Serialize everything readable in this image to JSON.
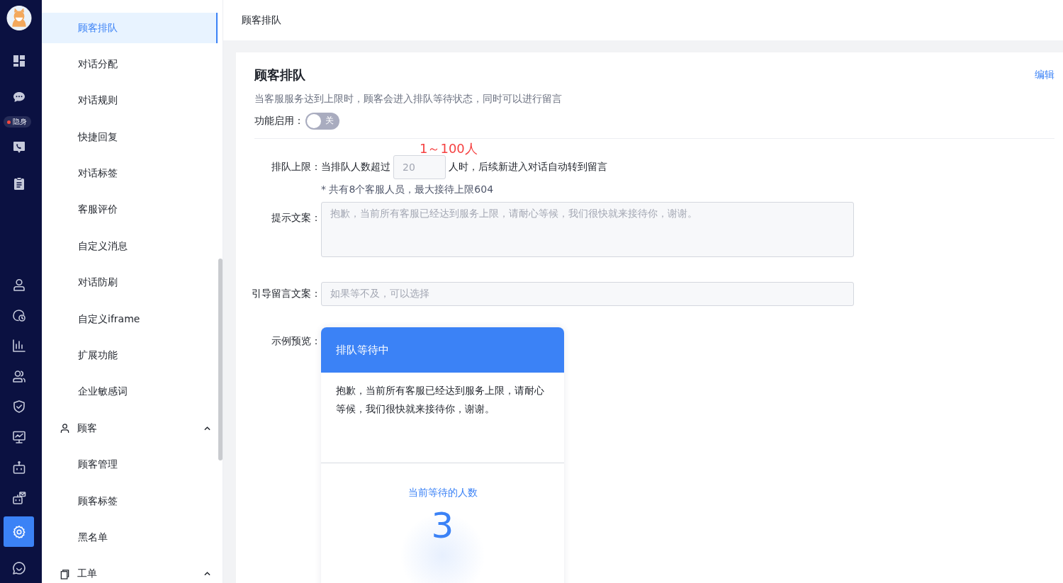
{
  "rail": {
    "items": [
      {
        "selected": false
      },
      {
        "selected": false
      },
      {
        "selected": false
      },
      {
        "selected": false
      },
      {
        "selected": false
      },
      {
        "selected": false
      },
      {
        "selected": false
      },
      {
        "selected": false
      },
      {
        "selected": false
      },
      {
        "selected": false
      },
      {
        "selected": false
      },
      {
        "selected": false
      },
      {
        "selected": true
      },
      {
        "selected": false
      }
    ],
    "status_badge": {
      "label": "隐身"
    }
  },
  "sidebar": {
    "items": [
      {
        "kind": "item",
        "label": "顾客排队",
        "selected": true
      },
      {
        "kind": "item",
        "label": "对话分配",
        "selected": false
      },
      {
        "kind": "item",
        "label": "对话规则",
        "selected": false
      },
      {
        "kind": "item",
        "label": "快捷回复",
        "selected": false
      },
      {
        "kind": "item",
        "label": "对话标签",
        "selected": false
      },
      {
        "kind": "item",
        "label": "客服评价",
        "selected": false
      },
      {
        "kind": "item",
        "label": "自定义消息",
        "selected": false
      },
      {
        "kind": "item",
        "label": "对话防刷",
        "selected": false
      },
      {
        "kind": "item",
        "label": "自定义iframe",
        "selected": false
      },
      {
        "kind": "item",
        "label": "扩展功能",
        "selected": false
      },
      {
        "kind": "item",
        "label": "企业敏感词",
        "selected": false
      },
      {
        "kind": "group",
        "label": "顾客",
        "expanded": true
      },
      {
        "kind": "item",
        "label": "顾客管理",
        "selected": false
      },
      {
        "kind": "item",
        "label": "顾客标签",
        "selected": false
      },
      {
        "kind": "item",
        "label": "黑名单",
        "selected": false
      },
      {
        "kind": "group",
        "label": "工单",
        "expanded": true
      }
    ]
  },
  "header": {
    "title": "顾客排队"
  },
  "card": {
    "title": "顾客排队",
    "edit_link": "编辑",
    "description": "当客服服务达到上限时，顾客会进入排队等待状态，同时可以进行留言",
    "toggle": {
      "label": "功能启用：",
      "on": false,
      "text": "关"
    },
    "limit": {
      "label": "排队上限：",
      "prefix": "当排队人数超过",
      "value": "20",
      "disabled": true,
      "suffix": "人时，后续新进入对话自动转到留言",
      "hint": "1～100人",
      "note": "* 共有8个客服人员，最大接待上限604"
    },
    "prompt": {
      "label": "提示文案：",
      "value": "抱歉，当前所有客服已经达到服务上限，请耐心等候，我们很快就来接待你，谢谢。",
      "disabled": true
    },
    "guide": {
      "label": "引导留言文案：",
      "value": "如果等不及，可以选择",
      "disabled": true
    },
    "preview": {
      "label": "示例预览：",
      "header": "排队等待中",
      "message": "抱歉，当前所有客服已经达到服务上限，请耐心等候，我们很快就来接待你，谢谢。",
      "count_label": "当前等待的人数",
      "count": "3"
    }
  }
}
